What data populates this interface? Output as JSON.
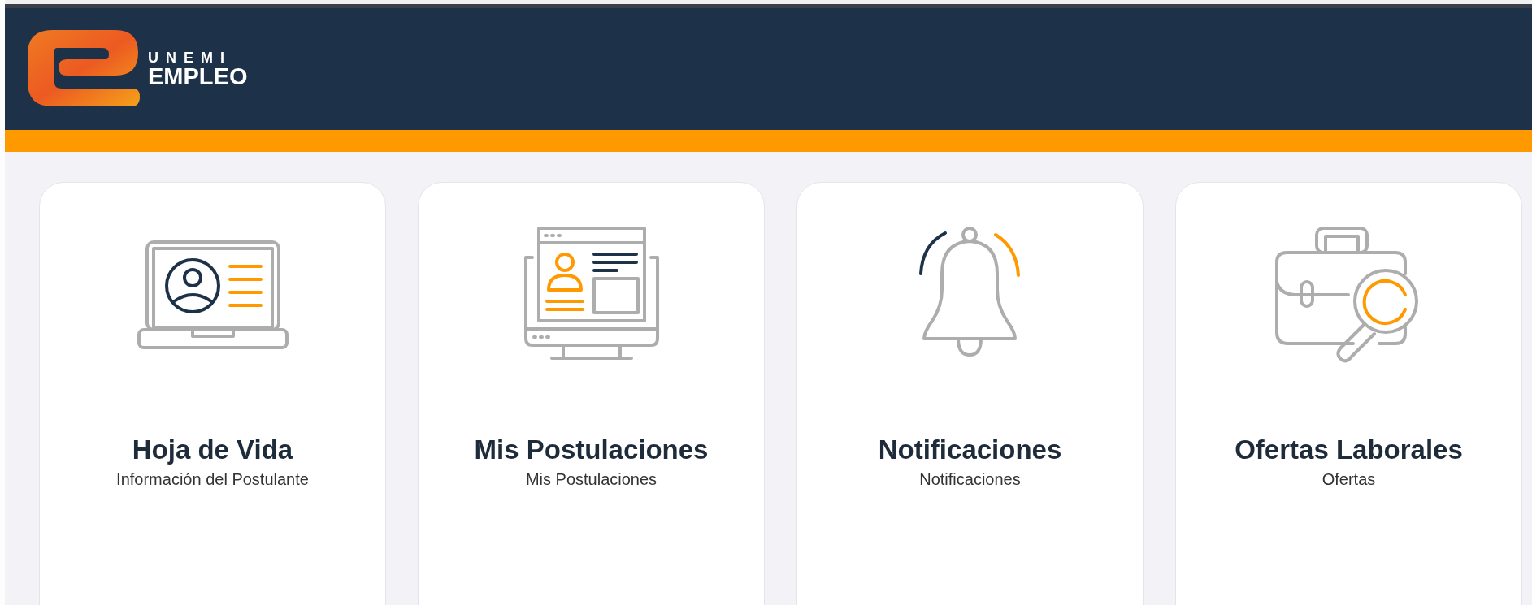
{
  "header": {
    "logo": {
      "line_1": "UNEMI",
      "line_2": "EMPLEO"
    }
  },
  "cards": [
    {
      "kind": "resume",
      "title": "Hoja de Vida",
      "subtitle": "Información del Postulante"
    },
    {
      "kind": "applications",
      "title": "Mis Postulaciones",
      "subtitle": "Mis Postulaciones"
    },
    {
      "kind": "bell",
      "title": "Notificaciones",
      "subtitle": "Notificaciones"
    },
    {
      "kind": "briefcase",
      "title": "Ofertas Laborales",
      "subtitle": "Ofertas"
    }
  ]
}
